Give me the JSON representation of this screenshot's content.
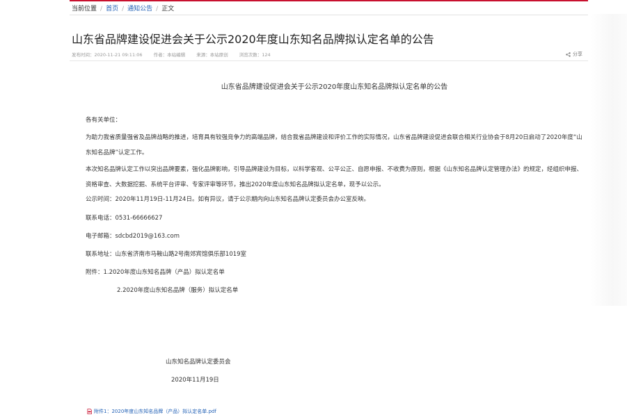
{
  "breadcrumb": {
    "current_label": "当前位置",
    "home": "首页",
    "section": "通知公告",
    "page": "正文"
  },
  "article": {
    "title": "山东省品牌建设促进会关于公示2020年度山东知名品牌拟认定名单的公告",
    "meta": {
      "published": "发布时间：2020-11-21 09:11:06",
      "author": "作者：本站编辑",
      "source": "来源：本站原创",
      "views": "浏览次数：124"
    },
    "share_label": "分享"
  },
  "body": {
    "doc_title": "山东省品牌建设促进会关于公示2020年度山东知名品牌拟认定名单的公告",
    "salutation": "各有关单位：",
    "para1": "为助力我省质量强省及品牌战略的推进，培育具有较强竞争力的高端品牌，结合我省品牌建设和评价工作的实际情况，山东省品牌建设促进会联合相关行业协会于8月20日启动了2020年度“山东知名品牌”认定工作。",
    "para2": "本次知名品牌认定工作以突出品牌要素，强化品牌影响，引导品牌建设为目标，以科学客观、公平公正、自愿申报、不收费为原则，根据《山东知名品牌认定管理办法》的规定，经组织申报、资格审查、大数据挖掘、系统平台评审、专家评审等环节，推出2020年度山东知名品牌拟认定名单，现予以公示。",
    "period": "公示时间：2020年11月19日-11月24日。如有异议，请于公示期内向山东知名品牌认定委员会办公室反映。",
    "phone": "联系电话：0531-66666627",
    "email": "电子邮箱：sdcbd2019@163.com",
    "address": "联系地址：山东省济南市马鞍山路2号南郊宾馆俱乐部1019室",
    "attachment1": "附件：1.2020年度山东知名品牌（产品）拟认定名单",
    "attachment2": "2.2020年度山东知名品牌（服务）拟认定名单",
    "signature": "山东知名品牌认定委员会",
    "date": "2020年11月19日"
  },
  "download": {
    "label": "附件1：2020年度山东知名品牌（产品）拟认定名单.pdf"
  },
  "colors": {
    "accent_red": "#c8102e",
    "link_blue": "#1f5fb5"
  },
  "icons": {
    "share": "share-icon",
    "attachment": "pdf-file-icon"
  }
}
